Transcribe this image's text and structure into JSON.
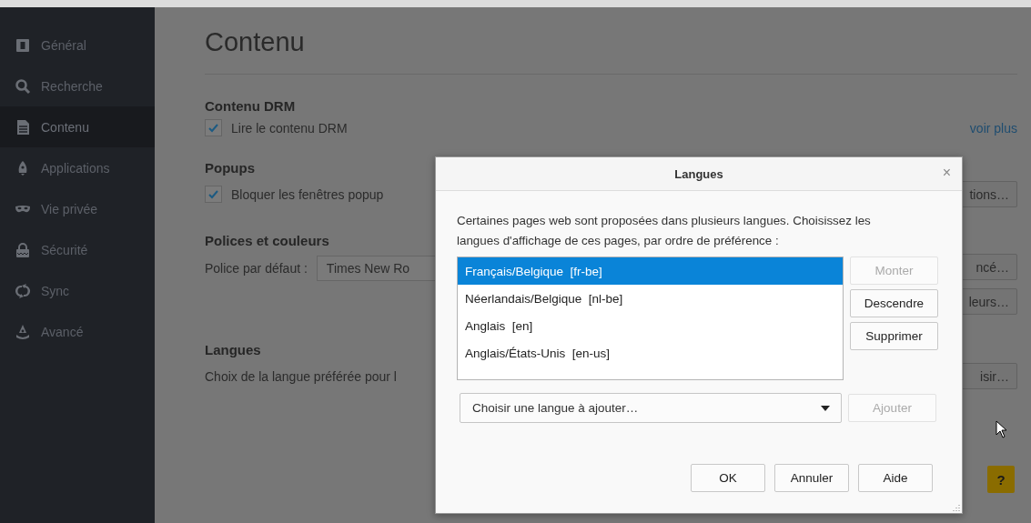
{
  "sidebar": {
    "items": [
      {
        "label": "Général",
        "selected": false
      },
      {
        "label": "Recherche",
        "selected": false
      },
      {
        "label": "Contenu",
        "selected": true
      },
      {
        "label": "Applications",
        "selected": false
      },
      {
        "label": "Vie privée",
        "selected": false
      },
      {
        "label": "Sécurité",
        "selected": false
      },
      {
        "label": "Sync",
        "selected": false
      },
      {
        "label": "Avancé",
        "selected": false
      }
    ]
  },
  "page": {
    "title": "Contenu",
    "drm": {
      "heading": "Contenu DRM",
      "checkbox": {
        "label": "Lire le contenu DRM",
        "checked": true
      },
      "link": "voir plus"
    },
    "popups": {
      "heading": "Popups",
      "checkbox": {
        "label": "Bloquer les fenêtres popup",
        "checked": true
      },
      "button": "tions…"
    },
    "fonts": {
      "heading": "Polices et couleurs",
      "label": "Police par défaut :",
      "font_field": "Times New Ro",
      "buttons": [
        "ncé…",
        "leurs…"
      ]
    },
    "languages": {
      "heading": "Langues",
      "description": "Choix de la langue préférée pour l",
      "button": "isir…"
    },
    "help_button": "?"
  },
  "dialog": {
    "title": "Langues",
    "close": "×",
    "description": "Certaines pages web sont proposées dans plusieurs langues. Choisissez les langues d'affichage de ces pages, par ordre de préférence :",
    "languages": [
      {
        "label": "Français/Belgique  [fr-be]",
        "selected": true
      },
      {
        "label": "Néerlandais/Belgique  [nl-be]",
        "selected": false
      },
      {
        "label": "Anglais  [en]",
        "selected": false
      },
      {
        "label": "Anglais/États-Unis  [en-us]",
        "selected": false
      }
    ],
    "side_buttons": [
      {
        "label": "Monter",
        "disabled": true
      },
      {
        "label": "Descendre",
        "disabled": false
      },
      {
        "label": "Supprimer",
        "disabled": false
      }
    ],
    "add_select": {
      "value": "Choisir une langue à ajouter…"
    },
    "add_button": {
      "label": "Ajouter",
      "disabled": true
    },
    "buttons": [
      "OK",
      "Annuler",
      "Aide"
    ]
  }
}
